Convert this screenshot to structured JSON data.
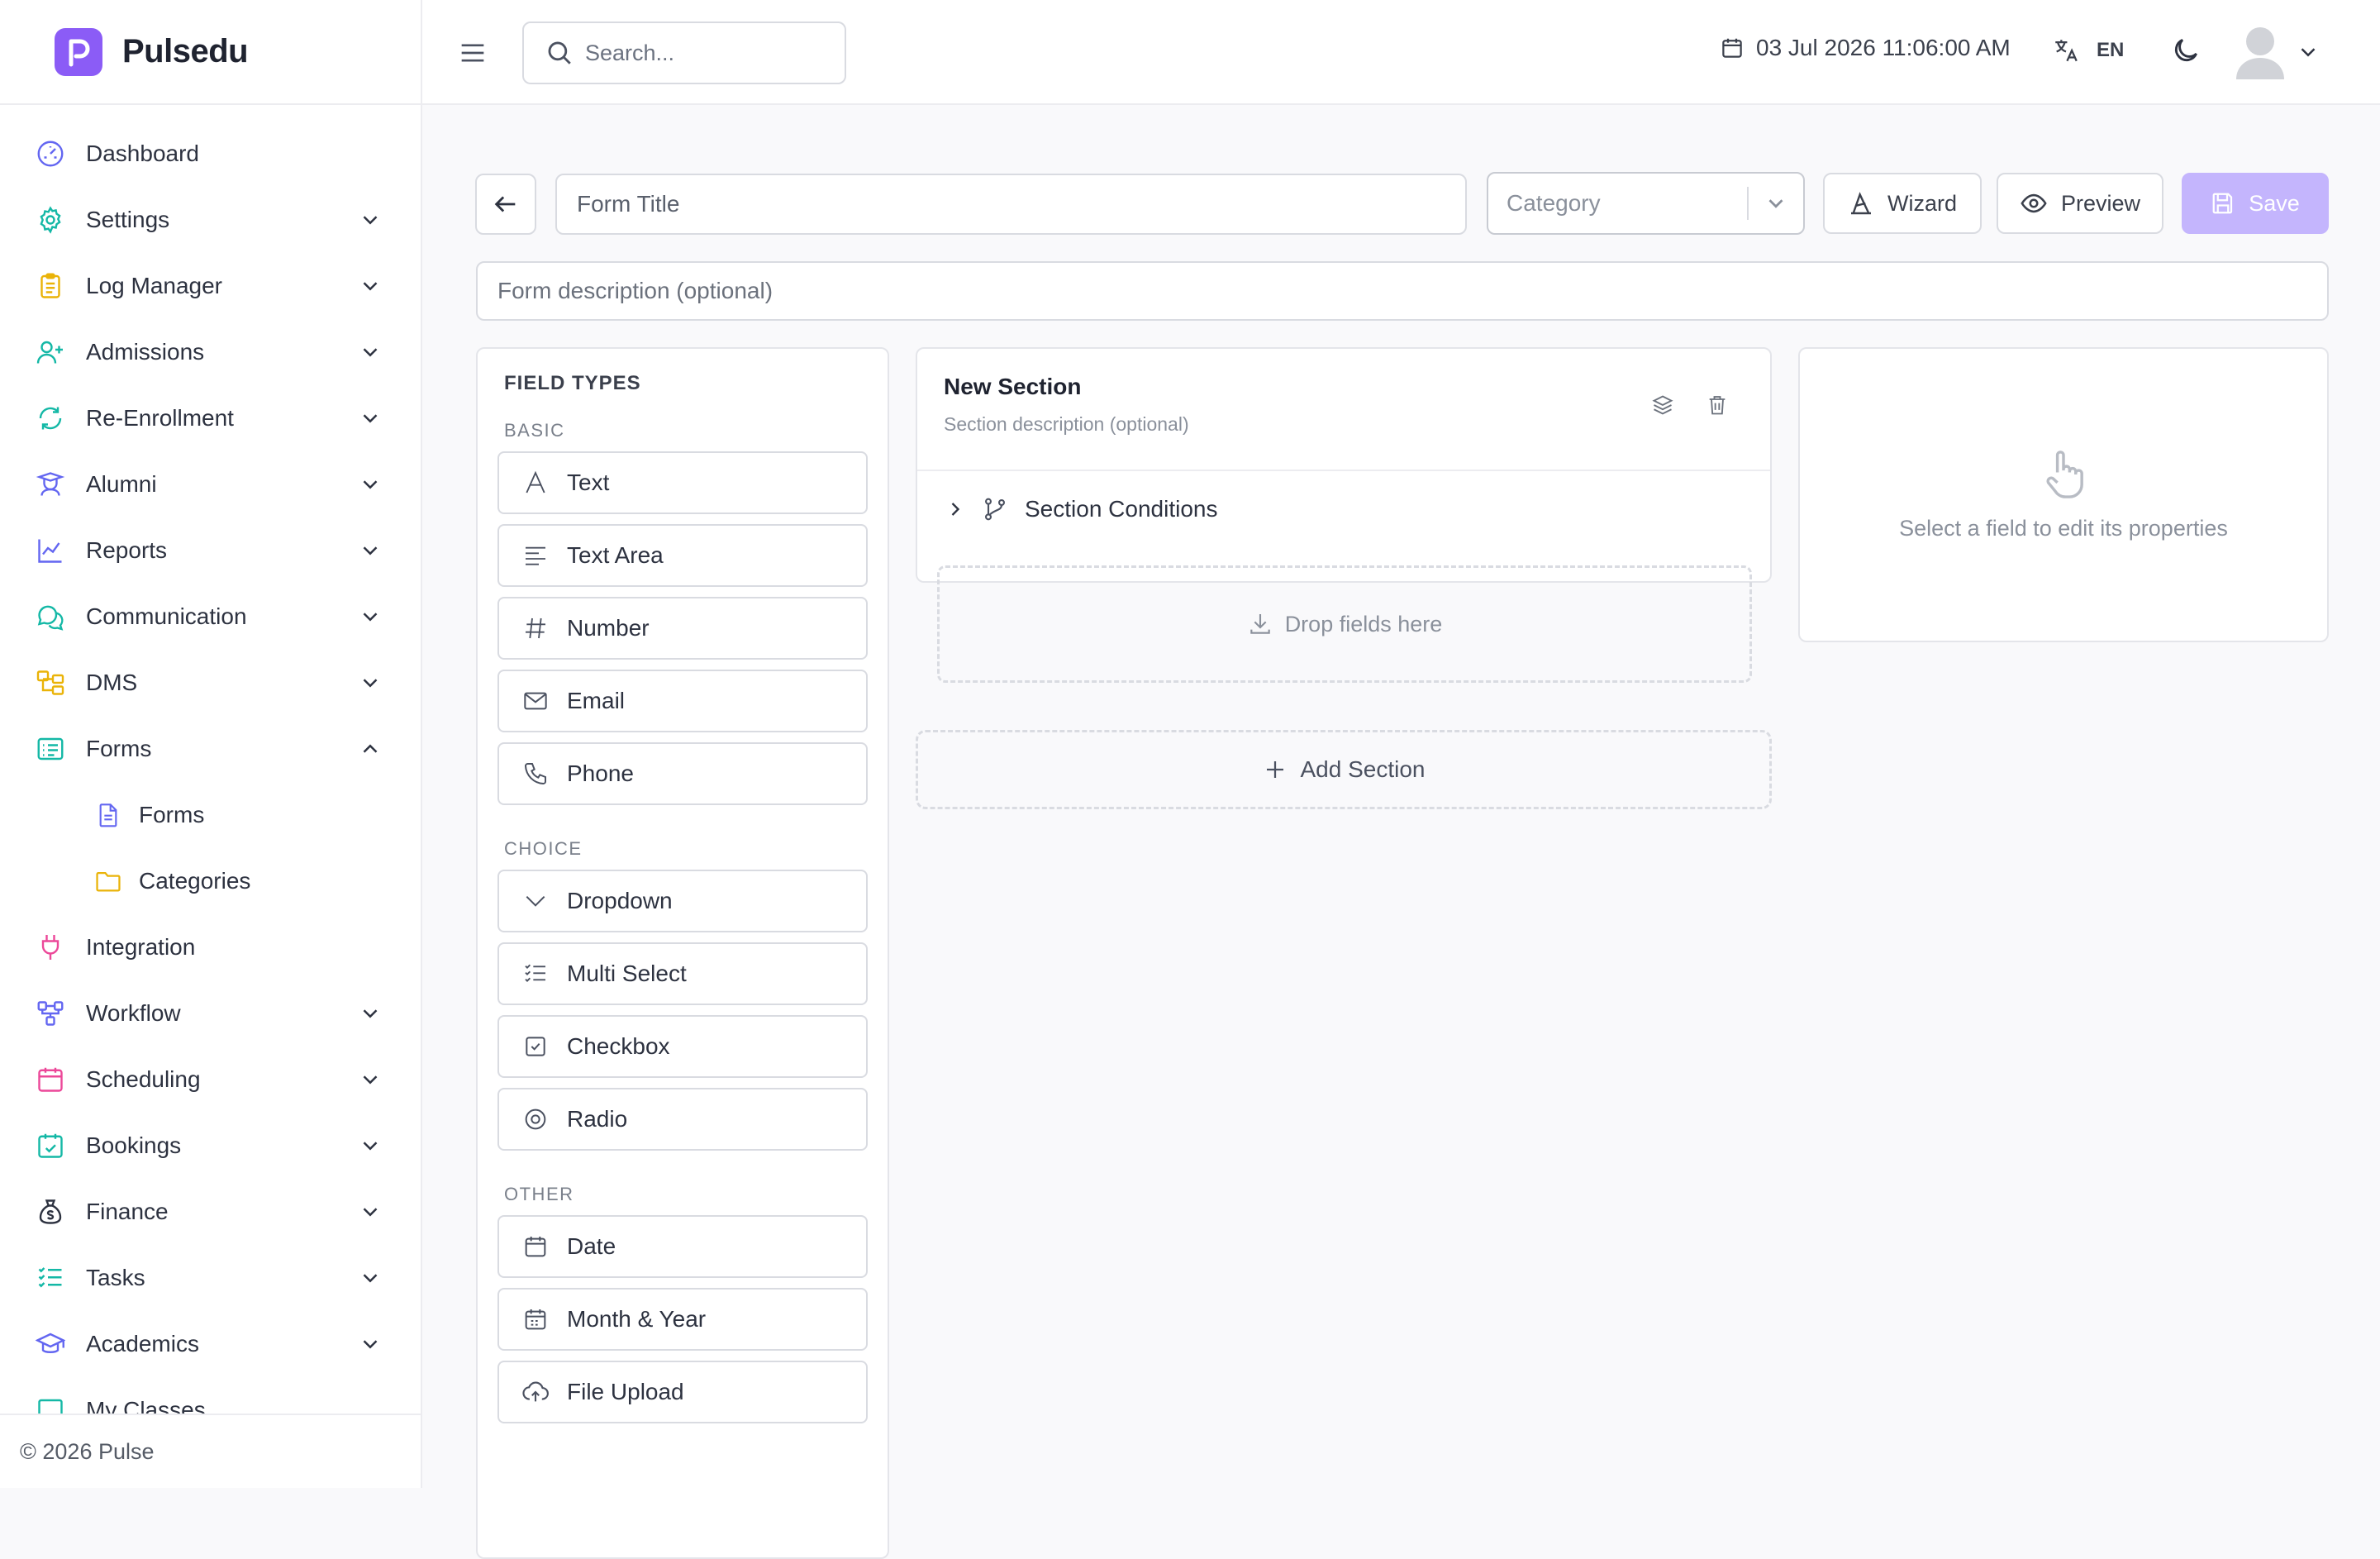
{
  "app": {
    "name": "Pulsedu",
    "footer": "© 2026 Pulse"
  },
  "topbar": {
    "search_placeholder": "Search...",
    "datetime": "03 Jul 2026 11:06:00 AM",
    "language": "EN"
  },
  "sidebar": {
    "items": [
      {
        "label": "Dashboard",
        "icon": "dashboard-icon",
        "color": "#6366f1"
      },
      {
        "label": "Settings",
        "icon": "gear-icon",
        "color": "#14b8a6"
      },
      {
        "label": "Log Manager",
        "icon": "clipboard-icon",
        "color": "#eab308"
      },
      {
        "label": "Admissions",
        "icon": "user-plus-icon",
        "color": "#14b8a6"
      },
      {
        "label": "Re-Enrollment",
        "icon": "refresh-icon",
        "color": "#14b8a6"
      },
      {
        "label": "Alumni",
        "icon": "graduate-icon",
        "color": "#6366f1"
      },
      {
        "label": "Reports",
        "icon": "chart-line-icon",
        "color": "#6366f1"
      },
      {
        "label": "Communication",
        "icon": "chat-icon",
        "color": "#14b8a6"
      },
      {
        "label": "DMS",
        "icon": "folder-tree-icon",
        "color": "#eab308"
      },
      {
        "label": "Forms",
        "icon": "form-list-icon",
        "color": "#14b8a6"
      },
      {
        "label": "Integration",
        "icon": "plug-icon",
        "color": "#ec4899"
      },
      {
        "label": "Workflow",
        "icon": "workflow-icon",
        "color": "#6366f1"
      },
      {
        "label": "Scheduling",
        "icon": "calendar-icon",
        "color": "#ec4899"
      },
      {
        "label": "Bookings",
        "icon": "calendar-check-icon",
        "color": "#14b8a6"
      },
      {
        "label": "Finance",
        "icon": "money-bag-icon",
        "color": "#2d3240"
      },
      {
        "label": "Tasks",
        "icon": "task-list-icon",
        "color": "#14b8a6"
      },
      {
        "label": "Academics",
        "icon": "graduation-cap-icon",
        "color": "#6366f1"
      },
      {
        "label": "My Classes",
        "icon": "classes-icon",
        "color": "#14b8a6"
      }
    ],
    "forms_sub": [
      {
        "label": "Forms",
        "icon": "document-icon",
        "color": "#6366f1"
      },
      {
        "label": "Categories",
        "icon": "folder-icon",
        "color": "#eab308"
      }
    ]
  },
  "editor": {
    "title_placeholder": "Form Title",
    "category_placeholder": "Category",
    "wizard_label": "Wizard",
    "preview_label": "Preview",
    "save_label": "Save",
    "description_placeholder": "Form description (optional)"
  },
  "field_types": {
    "heading": "FIELD TYPES",
    "basic_label": "BASIC",
    "basic": [
      "Text",
      "Text Area",
      "Number",
      "Email",
      "Phone"
    ],
    "choice_label": "CHOICE",
    "choice": [
      "Dropdown",
      "Multi Select",
      "Checkbox",
      "Radio"
    ],
    "other_label": "OTHER",
    "other": [
      "Date",
      "Month & Year",
      "File Upload"
    ]
  },
  "section": {
    "title": "New Section",
    "description": "Section description (optional)",
    "conditions_label": "Section Conditions",
    "drop_label": "Drop fields here",
    "add_label": "Add Section"
  },
  "properties": {
    "empty_message": "Select a field to edit its properties"
  }
}
